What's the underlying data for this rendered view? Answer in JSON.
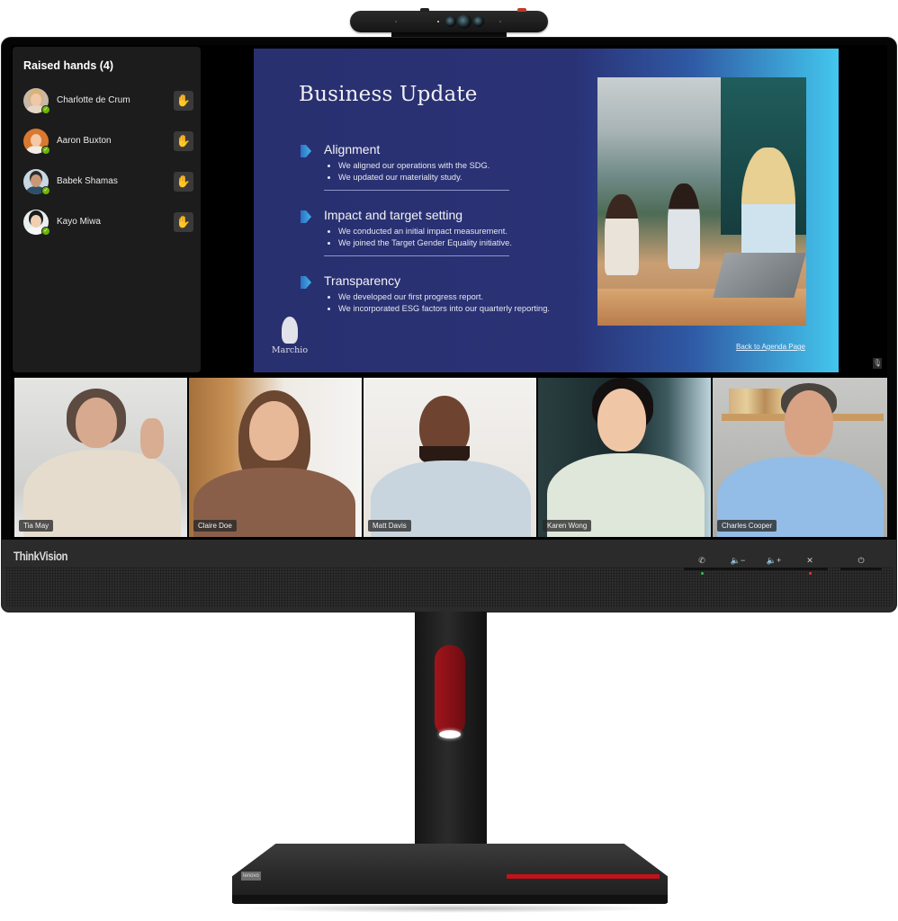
{
  "device": {
    "brand": "ThinkVision",
    "controls": [
      {
        "name": "call",
        "glyph": "✆"
      },
      {
        "name": "volume-down",
        "glyph": "🔈−"
      },
      {
        "name": "volume-up",
        "glyph": "🔈+"
      },
      {
        "name": "mic-mute",
        "glyph": "✕"
      },
      {
        "name": "power",
        "glyph": "⏻"
      }
    ],
    "base_badge": "lenovo"
  },
  "raised_hands": {
    "title": "Raised hands (4)",
    "people": [
      {
        "name": "Charlotte de Crum",
        "status": "available",
        "hand_icon": "✋"
      },
      {
        "name": "Aaron Buxton",
        "status": "available",
        "hand_icon": "✋"
      },
      {
        "name": "Babek Shamas",
        "status": "available",
        "hand_icon": "✋"
      },
      {
        "name": "Kayo Miwa",
        "status": "available",
        "hand_icon": "✋"
      }
    ],
    "presence_check": "✓"
  },
  "slide": {
    "title": "Business Update",
    "sections": [
      {
        "heading": "Alignment",
        "bullets": [
          "We aligned our operations with the SDG.",
          "We updated our materiality study."
        ]
      },
      {
        "heading": "Impact and target setting",
        "bullets": [
          "We conducted an initial impact measurement.",
          "We joined the Target Gender Equality initiative."
        ]
      },
      {
        "heading": "Transparency",
        "bullets": [
          "We developed our first progress report.",
          "We incorporated ESG factors into our  quarterly reporting."
        ]
      }
    ],
    "back_link": "Back to Agenda Page",
    "logo_text": "Marchio"
  },
  "presenter": {
    "mic_icon": "🎙"
  },
  "participants": [
    {
      "name": "Tia May"
    },
    {
      "name": "Claire Doe"
    },
    {
      "name": "Matt Davis"
    },
    {
      "name": "Karen Wong"
    },
    {
      "name": "Charles Cooper"
    }
  ]
}
